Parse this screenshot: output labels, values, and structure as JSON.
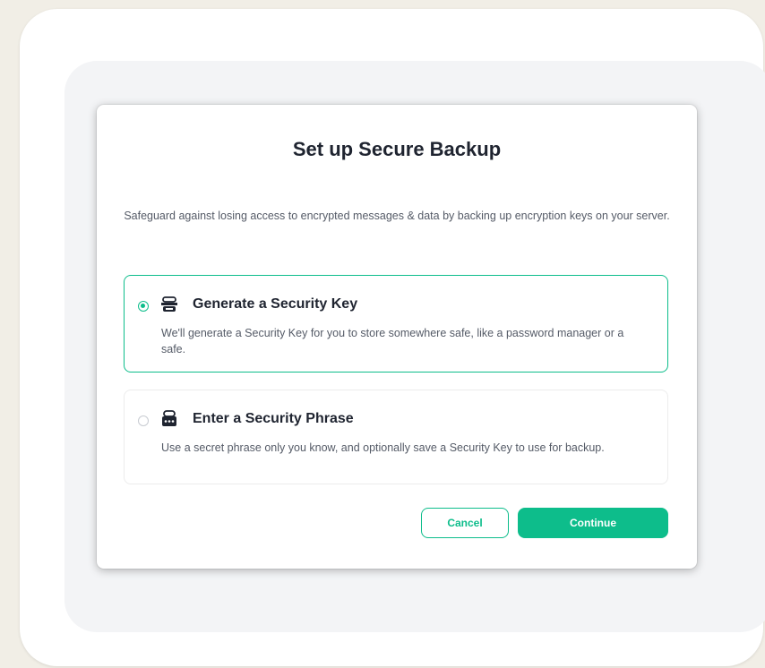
{
  "dialog": {
    "title": "Set up Secure Backup",
    "description": "Safeguard against losing access to encrypted messages & data by backing up encryption keys on your server."
  },
  "options": [
    {
      "title": "Generate a Security Key",
      "description": "We'll generate a Security Key for you to store somewhere safe, like a password manager or a safe.",
      "selected": true,
      "icon": "security-key-icon"
    },
    {
      "title": "Enter a Security Phrase",
      "description": "Use a secret phrase only you know, and optionally save a Security Key to use for backup.",
      "selected": false,
      "icon": "security-phrase-icon"
    }
  ],
  "buttons": {
    "cancel_label": "Cancel",
    "continue_label": "Continue"
  },
  "colors": {
    "accent": "#0dbd8b",
    "text_primary": "#1f2430",
    "text_secondary": "#555b67",
    "page_background": "#f1eee6"
  }
}
